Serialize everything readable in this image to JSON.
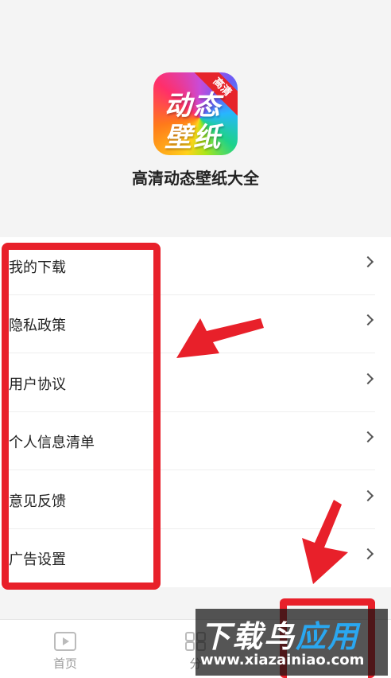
{
  "app": {
    "name": "高清动态壁纸大全",
    "icon": {
      "line1": "动态",
      "line2": "壁纸",
      "ribbon": "高清"
    }
  },
  "menu": {
    "items": [
      {
        "label": "我的下载",
        "icon": "chevron-right-icon"
      },
      {
        "label": "隐私政策",
        "icon": "chevron-right-icon"
      },
      {
        "label": "用户协议",
        "icon": "chevron-right-icon"
      },
      {
        "label": "个人信息清单",
        "icon": "chevron-right-icon"
      },
      {
        "label": "意见反馈",
        "icon": "chevron-right-icon"
      },
      {
        "label": "广告设置",
        "icon": "chevron-right-icon"
      }
    ]
  },
  "tabbar": {
    "tabs": [
      {
        "label": "首页",
        "icon": "play-icon"
      },
      {
        "label": "分",
        "icon": "grid-icon"
      }
    ]
  },
  "watermark": {
    "brand_a": "下载鸟",
    "brand_b": "应用",
    "url": "www.xiazainiao.com"
  },
  "colors": {
    "annotation_red": "#e8202a",
    "background": "#f4f4f4",
    "accent_blue": "#2aa7f0"
  }
}
